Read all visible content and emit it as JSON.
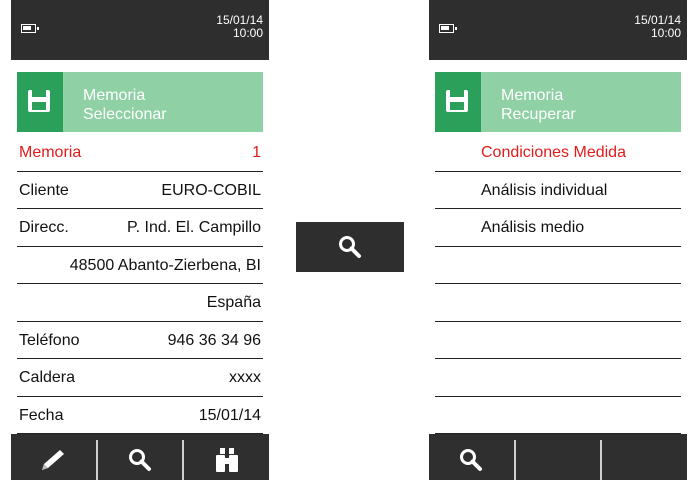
{
  "left_device": {
    "datetime": {
      "date": "15/01/14",
      "time": "10:00"
    },
    "header": {
      "line1": "Memoria",
      "line2": "Seleccionar",
      "icon": "floppy-disk-icon"
    },
    "rows": [
      {
        "label": "Memoria",
        "value": "1"
      },
      {
        "label": "Cliente",
        "value": "EURO-COBIL"
      },
      {
        "label": "Direcc.",
        "value": "P. Ind. El. Campillo"
      },
      {
        "label": "",
        "value": "48500 Abanto-Zierbena, BI"
      },
      {
        "label": "",
        "value": "España"
      },
      {
        "label": "Teléfono",
        "value": "946 36 34 96"
      },
      {
        "label": "Caldera",
        "value": "xxxx"
      },
      {
        "label": "Fecha",
        "value": "15/01/14"
      }
    ],
    "toolbar": [
      "pencil-icon",
      "magnifier-icon",
      "binoculars-icon"
    ]
  },
  "center_button": {
    "icon": "magnifier-icon"
  },
  "right_device": {
    "datetime": {
      "date": "15/01/14",
      "time": "10:00"
    },
    "header": {
      "line1": "Memoria",
      "line2": "Recuperar",
      "icon": "floppy-disk-icon"
    },
    "items": [
      "Condiciones Medida",
      "Análisis individual",
      "Análisis medio",
      "",
      "",
      "",
      "",
      ""
    ],
    "toolbar": [
      "magnifier-icon",
      "",
      ""
    ]
  },
  "colors": {
    "accent_dark": "#2aa05a",
    "accent_light": "#8fd0a5",
    "selected_text": "#e41b1b",
    "chrome": "#2e2e2e"
  }
}
